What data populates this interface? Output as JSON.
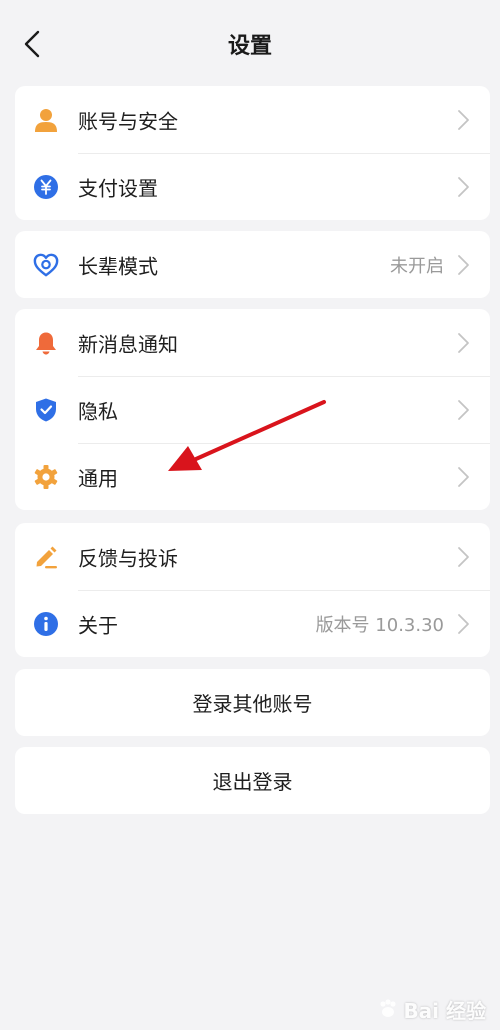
{
  "header": {
    "title": "设置"
  },
  "groups": {
    "account": [
      {
        "label": "账号与安全",
        "icon": "person-icon"
      },
      {
        "label": "支付设置",
        "icon": "yuan-icon"
      }
    ],
    "elder": [
      {
        "label": "长辈模式",
        "value": "未开启",
        "icon": "heart-icon"
      }
    ],
    "system": [
      {
        "label": "新消息通知",
        "icon": "bell-icon"
      },
      {
        "label": "隐私",
        "icon": "shield-check-icon"
      },
      {
        "label": "通用",
        "icon": "gear-icon"
      }
    ],
    "about": [
      {
        "label": "反馈与投诉",
        "icon": "pencil-icon"
      },
      {
        "label": "关于",
        "value": "版本号 10.3.30",
        "icon": "info-icon"
      }
    ]
  },
  "actions": {
    "switch_account": "登录其他账号",
    "logout": "退出登录"
  },
  "watermark": {
    "text": "Bai 经验"
  },
  "colors": {
    "orange": "#f2a23c",
    "blue": "#2f6fe6",
    "red_orange": "#ef6a3a",
    "annotation_red": "#d9141c"
  }
}
